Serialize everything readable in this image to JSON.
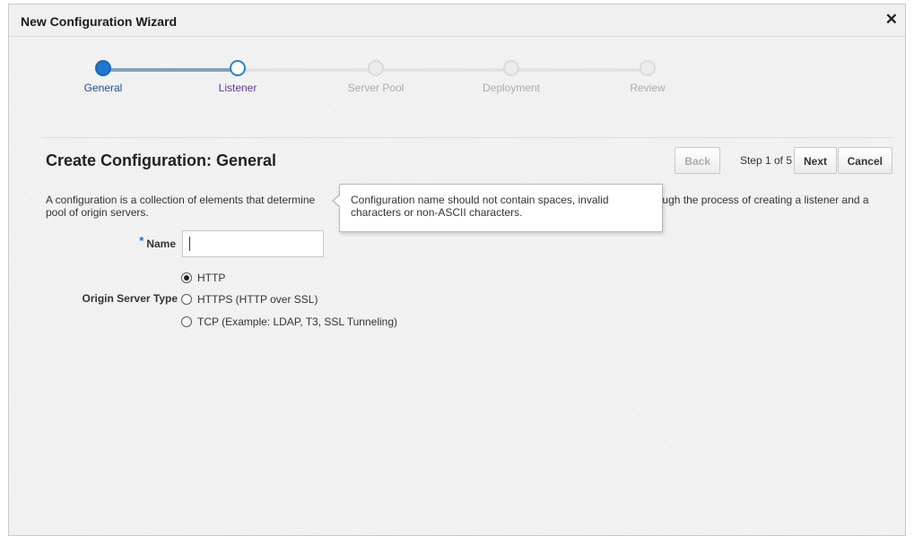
{
  "dialog": {
    "title": "New Configuration Wizard",
    "close_glyph": "✕"
  },
  "train": {
    "steps": [
      {
        "label": "General",
        "state": "complete"
      },
      {
        "label": "Listener",
        "state": "current"
      },
      {
        "label": "Server Pool",
        "state": "future"
      },
      {
        "label": "Deployment",
        "state": "future"
      },
      {
        "label": "Review",
        "state": "future"
      }
    ]
  },
  "page": {
    "title": "Create Configuration: General",
    "description": "A configuration is a collection of elements that determine                                                                         The wizard guides you through the process of creating a listener and a pool of origin servers."
  },
  "toolbar": {
    "back_label": "Back",
    "step_text": "Step 1 of 5",
    "next_label": "Next",
    "cancel_label": "Cancel"
  },
  "tooltip": {
    "text": "Configuration name should not contain spaces, invalid characters or non-ASCII characters."
  },
  "form": {
    "name": {
      "required_mark": "*",
      "label": "Name",
      "value": ""
    },
    "origin_server_type": {
      "label": "Origin Server Type",
      "options": [
        {
          "label": "HTTP",
          "checked": true
        },
        {
          "label": "HTTPS (HTTP over SSL)",
          "checked": false
        },
        {
          "label": "TCP (Example: LDAP, T3, SSL Tunneling)",
          "checked": false
        }
      ]
    }
  },
  "colors": {
    "accent": "#1f77d0",
    "current_step_label": "#5a3a8a",
    "future_step": "#aaaaaa"
  }
}
